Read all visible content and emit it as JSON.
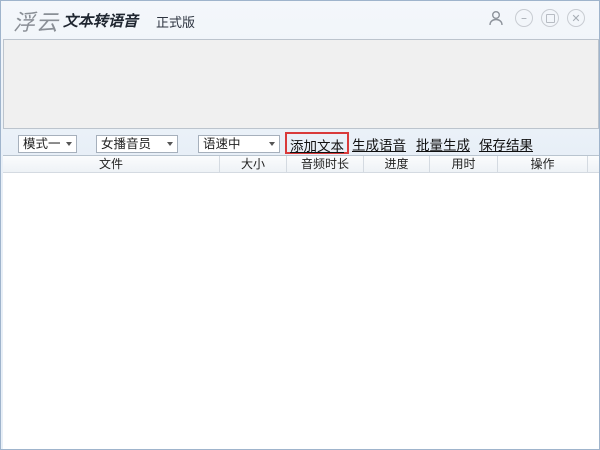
{
  "app": {
    "brand": "浮云",
    "title": "文本转语音",
    "edition": "正式版"
  },
  "toolbar": {
    "mode": "模式一",
    "voice": "女播音员",
    "speed": "语速中",
    "add_text": "添加文本",
    "generate": "生成语音",
    "batch": "批量生成",
    "save": "保存结果"
  },
  "table": {
    "columns": [
      "文件",
      "大小",
      "音频时长",
      "进度",
      "用时",
      "操作"
    ],
    "rows": []
  },
  "colors": {
    "highlight_border": "#d93a3a",
    "window_border": "#9fb4cc"
  }
}
